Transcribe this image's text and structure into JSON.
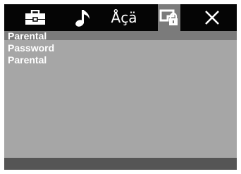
{
  "tabs": [
    {
      "icon": "toolbox-icon",
      "active": false
    },
    {
      "icon": "music-note-icon",
      "active": false
    },
    {
      "icon": "language-icon",
      "active": false,
      "glyph": "Åçä"
    },
    {
      "icon": "parental-lock-icon",
      "active": true
    },
    {
      "icon": "close-icon",
      "active": false
    }
  ],
  "menu": {
    "items": [
      "Parental",
      "Password",
      "Parental"
    ]
  },
  "colors": {
    "topbar": "#050505",
    "panel": "#a6a6a6",
    "highlight": "#7b7b7b",
    "bottombar": "#555555",
    "text": "#ffffff"
  }
}
